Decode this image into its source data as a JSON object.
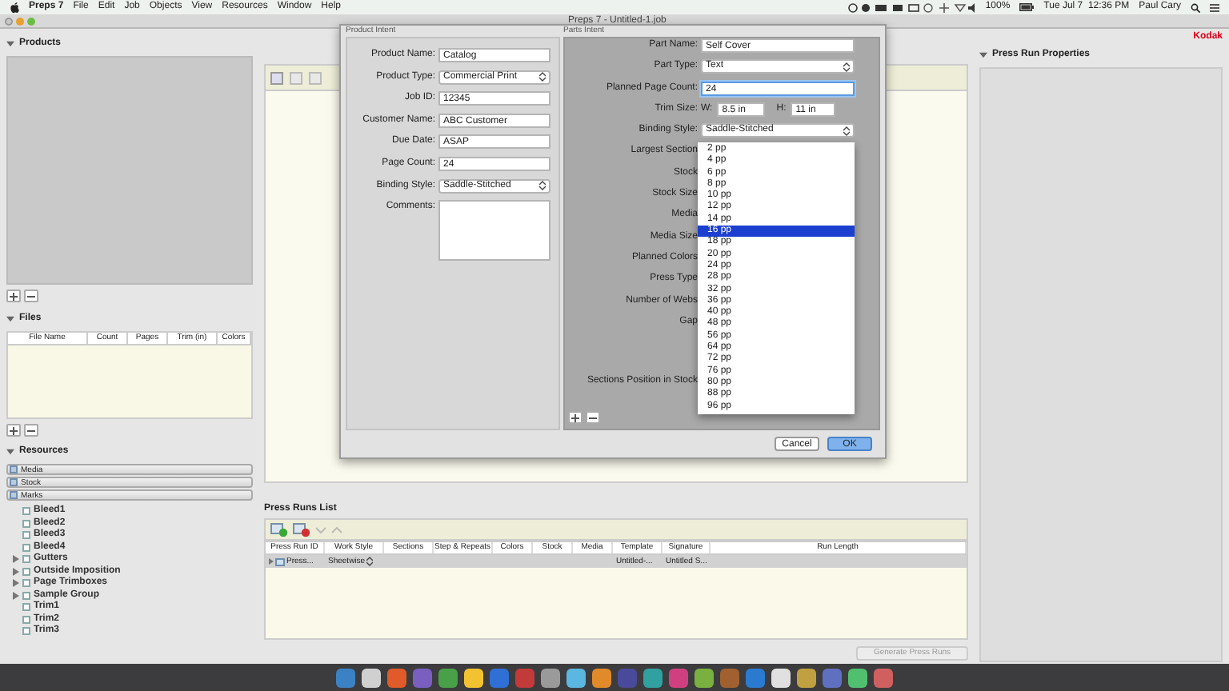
{
  "menu_bar": {
    "app": "Preps 7",
    "items": [
      "File",
      "Edit",
      "Job",
      "Objects",
      "View",
      "Resources",
      "Window",
      "Help"
    ],
    "battery": "100%",
    "clock": "Tue Jul 7  12:36 PM",
    "user": "Paul Cary"
  },
  "window": {
    "title": "Preps 7 - Untitled-1.job",
    "logo": "Kodak"
  },
  "products": {
    "title": "Products"
  },
  "files": {
    "title": "Files",
    "columns": [
      "File Name",
      "Count",
      "Pages",
      "Trim (in)",
      "Colors"
    ]
  },
  "resources": {
    "title": "Resources",
    "categories": [
      "Media",
      "Stock",
      "Marks"
    ],
    "tree": [
      {
        "label": "Bleed1",
        "kind": "leaf"
      },
      {
        "label": "Bleed2",
        "kind": "leaf"
      },
      {
        "label": "Bleed3",
        "kind": "leaf"
      },
      {
        "label": "Bleed4",
        "kind": "leaf"
      },
      {
        "label": "Gutters",
        "kind": "group"
      },
      {
        "label": "Outside Imposition",
        "kind": "group"
      },
      {
        "label": "Page Trimboxes",
        "kind": "group"
      },
      {
        "label": "Sample Group",
        "kind": "group"
      },
      {
        "label": "Trim1",
        "kind": "leaf"
      },
      {
        "label": "Trim2",
        "kind": "leaf"
      },
      {
        "label": "Trim3",
        "kind": "leaf"
      }
    ]
  },
  "dialog": {
    "product_intent": {
      "title": "Product Intent",
      "fields": [
        {
          "label": "Product Name:",
          "value": "Catalog",
          "kind": "text"
        },
        {
          "label": "Product Type:",
          "value": "Commercial Print",
          "kind": "select"
        },
        {
          "label": "Job ID:",
          "value": "12345",
          "kind": "text"
        },
        {
          "label": "Customer Name:",
          "value": "ABC Customer",
          "kind": "text"
        },
        {
          "label": "Due Date:",
          "value": "ASAP",
          "kind": "text"
        },
        {
          "label": "Page Count:",
          "value": "24",
          "kind": "text"
        },
        {
          "label": "Binding Style:",
          "value": "Saddle-Stitched",
          "kind": "select"
        },
        {
          "label": "Comments:",
          "kind": "textarea"
        }
      ]
    },
    "parts_intent": {
      "title": "Parts Intent",
      "fields": [
        {
          "label": "Part Name:",
          "value": "Self Cover",
          "kind": "text",
          "focused": false
        },
        {
          "label": "Part Type:",
          "value": "Text",
          "kind": "select"
        },
        {
          "label": "Planned Page Count:",
          "value": "24",
          "kind": "text",
          "focused": true
        },
        {
          "label": "Trim Size:",
          "kind": "size",
          "w_label": "W:",
          "w": "8.5 in",
          "h_label": "H:",
          "h": "11 in"
        },
        {
          "label": "Binding Style:",
          "value": "Saddle-Stitched",
          "kind": "select"
        },
        {
          "label": "Largest Section",
          "kind": "covered"
        },
        {
          "label": "Stock",
          "kind": "covered"
        },
        {
          "label": "Stock Size",
          "kind": "covered"
        },
        {
          "label": "Media",
          "kind": "covered"
        },
        {
          "label": "Media Size",
          "kind": "covered"
        },
        {
          "label": "Planned Colors",
          "kind": "covered"
        },
        {
          "label": "Press Type",
          "kind": "covered"
        },
        {
          "label": "Number of Webs",
          "kind": "covered"
        },
        {
          "label": "Gap",
          "kind": "covered"
        },
        {
          "label": "Sections Position in Stock",
          "kind": "covered_far"
        }
      ]
    },
    "dropdown": [
      {
        "label": "2 pp",
        "selected": false
      },
      {
        "label": "4 pp",
        "selected": false
      },
      {
        "label": "6 pp",
        "selected": false
      },
      {
        "label": "8 pp",
        "selected": false
      },
      {
        "label": "10 pp",
        "selected": false
      },
      {
        "label": "12 pp",
        "selected": false
      },
      {
        "label": "14 pp",
        "selected": false
      },
      {
        "label": "16 pp",
        "selected": true
      },
      {
        "label": "18 pp",
        "selected": false
      },
      {
        "label": "20 pp",
        "selected": false
      },
      {
        "label": "24 pp",
        "selected": false
      },
      {
        "label": "28 pp",
        "selected": false
      },
      {
        "label": "32 pp",
        "selected": false
      },
      {
        "label": "36 pp",
        "selected": false
      },
      {
        "label": "40 pp",
        "selected": false
      },
      {
        "label": "48 pp",
        "selected": false
      },
      {
        "label": "56 pp",
        "selected": false
      },
      {
        "label": "64 pp",
        "selected": false
      },
      {
        "label": "72 pp",
        "selected": false
      },
      {
        "label": "76 pp",
        "selected": false
      },
      {
        "label": "80 pp",
        "selected": false
      },
      {
        "label": "88 pp",
        "selected": false
      },
      {
        "label": "96 pp",
        "selected": false
      }
    ],
    "buttons": [
      {
        "label": "Cancel",
        "default": false
      },
      {
        "label": "OK",
        "default": true
      }
    ]
  },
  "press_runs": {
    "title": "Press Runs List",
    "columns": [
      "Press Run ID",
      "Work Style",
      "Sections",
      "Step & Repeats",
      "Colors",
      "Stock",
      "Media",
      "Template",
      "Signature",
      "Run Length"
    ],
    "rows": [
      {
        "press_run_id": "Press...",
        "work_style": "Sheetwise",
        "template": "Untitled-...",
        "signature": "Untitled S..."
      }
    ],
    "generate_button": {
      "label": "Generate Press Runs",
      "disabled": true
    }
  },
  "press_run_properties": {
    "title": "Press Run Properties"
  }
}
